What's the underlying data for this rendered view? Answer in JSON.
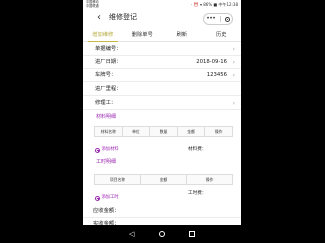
{
  "status_bar": {
    "carrier": "中国移动\n中国联通",
    "right": "· ⏰ ▾ 86% ■ 中午12:38"
  },
  "nav": {
    "title": "维修登记"
  },
  "tabs": [
    {
      "label": "增加维修",
      "active": true
    },
    {
      "label": "删除单号",
      "active": false
    },
    {
      "label": "刷新",
      "active": false
    },
    {
      "label": "历史",
      "active": false
    }
  ],
  "form": {
    "order_no_label": "单据编号：",
    "date_label": "进厂日期：",
    "date_value": "2018-09-16",
    "plate_label": "车牌号：",
    "plate_value": "123456",
    "mileage_label": "进厂里程：",
    "repairer_label": "修理工："
  },
  "materials": {
    "section_title": "材料明细",
    "headers": [
      "材料名称",
      "单位",
      "数量",
      "金额",
      "操作"
    ],
    "add_label": "添加材料",
    "fee_label": "材料费："
  },
  "labor": {
    "section_title": "工时明细",
    "headers": [
      "项目名称",
      "金额",
      "操作"
    ],
    "add_label": "添加工时",
    "fee_label": "工时费："
  },
  "totals": {
    "receivable_label": "应收金额：",
    "received_label": "实收金额："
  }
}
